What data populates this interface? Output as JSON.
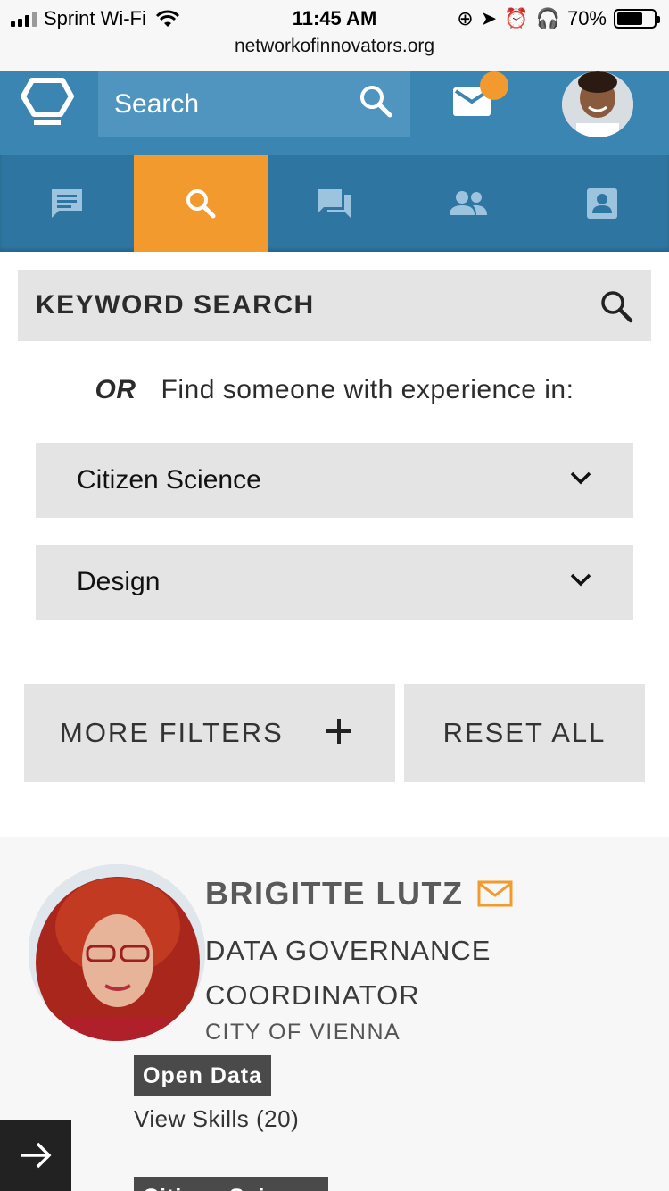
{
  "status_bar": {
    "carrier": "Sprint Wi-Fi",
    "time": "11:45 AM",
    "battery": "70%",
    "url": "networkofinnovators.org"
  },
  "header": {
    "search_placeholder": "Search",
    "notification_dot_color": "#f39a2e",
    "brand_color": "#3b85b2"
  },
  "tabs": [
    {
      "name": "posts",
      "icon": "comment-icon",
      "active": false
    },
    {
      "name": "search",
      "icon": "search-icon",
      "active": true
    },
    {
      "name": "discussions",
      "icon": "forum-icon",
      "active": false
    },
    {
      "name": "people",
      "icon": "people-icon",
      "active": false
    },
    {
      "name": "profile",
      "icon": "contact-card-icon",
      "active": false
    }
  ],
  "keyword_search": {
    "label": "KEYWORD SEARCH"
  },
  "experience": {
    "or_label": "OR",
    "prompt": "Find someone with experience in:",
    "select_1": "Citizen Science",
    "select_2": "Design"
  },
  "filters": {
    "more_label": "MORE FILTERS",
    "reset_label": "RESET ALL"
  },
  "result": {
    "name": "BRIGITTE LUTZ",
    "title": "DATA GOVERNANCE COORDINATOR",
    "org": "CITY OF VIENNA",
    "tag": "Open Data",
    "view_skills": "View Skills (20)",
    "next_tag": "Citizen Science"
  }
}
